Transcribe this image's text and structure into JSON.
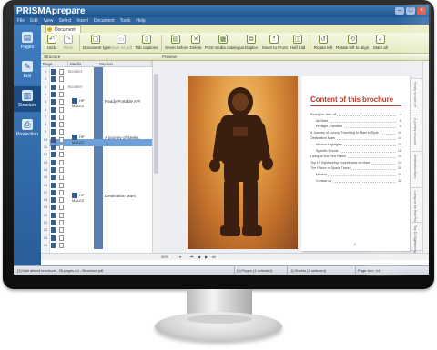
{
  "app": {
    "title": "PRISMAprepare"
  },
  "menu": [
    "File",
    "Edit",
    "View",
    "Select",
    "Insert",
    "Document",
    "Tools",
    "Help"
  ],
  "sidebar": [
    {
      "label": "Pages",
      "icon": "pages-icon"
    },
    {
      "label": "Edit",
      "icon": "edit-icon"
    },
    {
      "label": "Structure",
      "icon": "structure-icon"
    },
    {
      "label": "Production",
      "icon": "production-icon"
    }
  ],
  "document_tab": "Document",
  "ribbon": [
    {
      "label": "Undo",
      "icon": "undo-icon",
      "enabled": true
    },
    {
      "label": "Redo",
      "icon": "redo-icon",
      "enabled": false
    },
    {
      "label": "Document type",
      "icon": "document-type-icon",
      "enabled": true
    },
    {
      "label": "Save as pdf",
      "icon": "save-icon",
      "enabled": false
    },
    {
      "label": "Tab captions",
      "icon": "tab-captions-icon",
      "enabled": true
    },
    {
      "label": "Sheet before",
      "icon": "sheet-before-icon",
      "enabled": true
    },
    {
      "label": "Delete",
      "icon": "delete-icon",
      "enabled": true
    },
    {
      "label": "Print media catalogue",
      "icon": "media-catalogue-icon",
      "enabled": true
    },
    {
      "label": "Duplex",
      "icon": "duplex-icon",
      "enabled": true
    },
    {
      "label": "Move to Front",
      "icon": "move-front-icon",
      "enabled": true
    },
    {
      "label": "Half fold",
      "icon": "half-fold-icon",
      "enabled": true
    },
    {
      "label": "Rotate left",
      "icon": "rotate-left-icon",
      "enabled": true
    },
    {
      "label": "Rotate left to align",
      "icon": "rotate-align-icon",
      "enabled": true
    },
    {
      "label": "Mark all",
      "icon": "mark-icon",
      "enabled": true
    }
  ],
  "structure_panel": {
    "header": "Structure",
    "columns": [
      "Page",
      "Media",
      "Section"
    ],
    "rows": [
      {
        "n": "1",
        "label": "Booklet"
      },
      {
        "n": "2",
        "label": ""
      },
      {
        "n": "3",
        "label": "Booklet"
      },
      {
        "n": "4",
        "label": ""
      },
      {
        "n": "5",
        "label": ""
      },
      {
        "n": "6",
        "label": ""
      },
      {
        "n": "7",
        "label": ""
      },
      {
        "n": "8",
        "label": ""
      },
      {
        "n": "9",
        "label": ""
      },
      {
        "n": "10",
        "label": ""
      },
      {
        "n": "11",
        "label": ""
      },
      {
        "n": "12",
        "label": ""
      },
      {
        "n": "13",
        "label": ""
      },
      {
        "n": "14",
        "label": ""
      },
      {
        "n": "15",
        "label": ""
      },
      {
        "n": "16",
        "label": ""
      },
      {
        "n": "17",
        "label": ""
      },
      {
        "n": "18",
        "label": ""
      },
      {
        "n": "19",
        "label": ""
      },
      {
        "n": "20",
        "label": ""
      },
      {
        "n": "21",
        "label": ""
      },
      {
        "n": "22",
        "label": ""
      },
      {
        "n": "23",
        "label": ""
      },
      {
        "n": "24",
        "label": ""
      }
    ],
    "media": [
      "HP MALEZ",
      "HP MALEZ",
      "HP MALEZ"
    ],
    "sections": [
      "Ready Portable API",
      "A journey of Seeks",
      "Destination Mars"
    ]
  },
  "preview_panel": {
    "header": "Preview"
  },
  "brochure": {
    "title": "Content of this brochure",
    "toc": [
      {
        "text": "Ready for take off",
        "page": "4",
        "sub": false
      },
      {
        "text": "Air Mars",
        "page": "6",
        "sub": true
      },
      {
        "text": "Preflight Checklist",
        "page": "8",
        "sub": true
      },
      {
        "text": "A Journey of Luxury, Travelling to Mars in Style",
        "page": "10",
        "sub": false
      },
      {
        "text": "Destination Mars",
        "page": "14",
        "sub": false
      },
      {
        "text": "Mission Highlights",
        "page": "16",
        "sub": true
      },
      {
        "text": "Specific Events",
        "page": "18",
        "sub": true
      },
      {
        "text": "Living on the Red Planet",
        "page": "20",
        "sub": false
      },
      {
        "text": "Top 10 Sightseeing Experiences on Mars",
        "page": "24",
        "sub": false
      },
      {
        "text": "The Future of Space Travel",
        "page": "28",
        "sub": false
      },
      {
        "text": "Mission",
        "page": "30",
        "sub": true
      },
      {
        "text": "Contact us",
        "page": "32",
        "sub": true
      }
    ],
    "page_number": "2"
  },
  "side_tabs": [
    "Ready for take off",
    "A journey of Luxury",
    "Destination Mars",
    "Living on the Red Planet",
    "Top 10 Sightseeing"
  ],
  "zoom": "50%",
  "status": {
    "left": "[1] Mail attend brochure - 28 pages A4 - Brochure.pdf",
    "pages": "[1] Pages (1 selected)",
    "sheets": "[1] Sheets (1 selected)",
    "size": "Page size: A4"
  },
  "colors": {
    "accent": "#2d64a0",
    "toc_red": "#c0392b",
    "ribbon": "#e9edc6"
  }
}
